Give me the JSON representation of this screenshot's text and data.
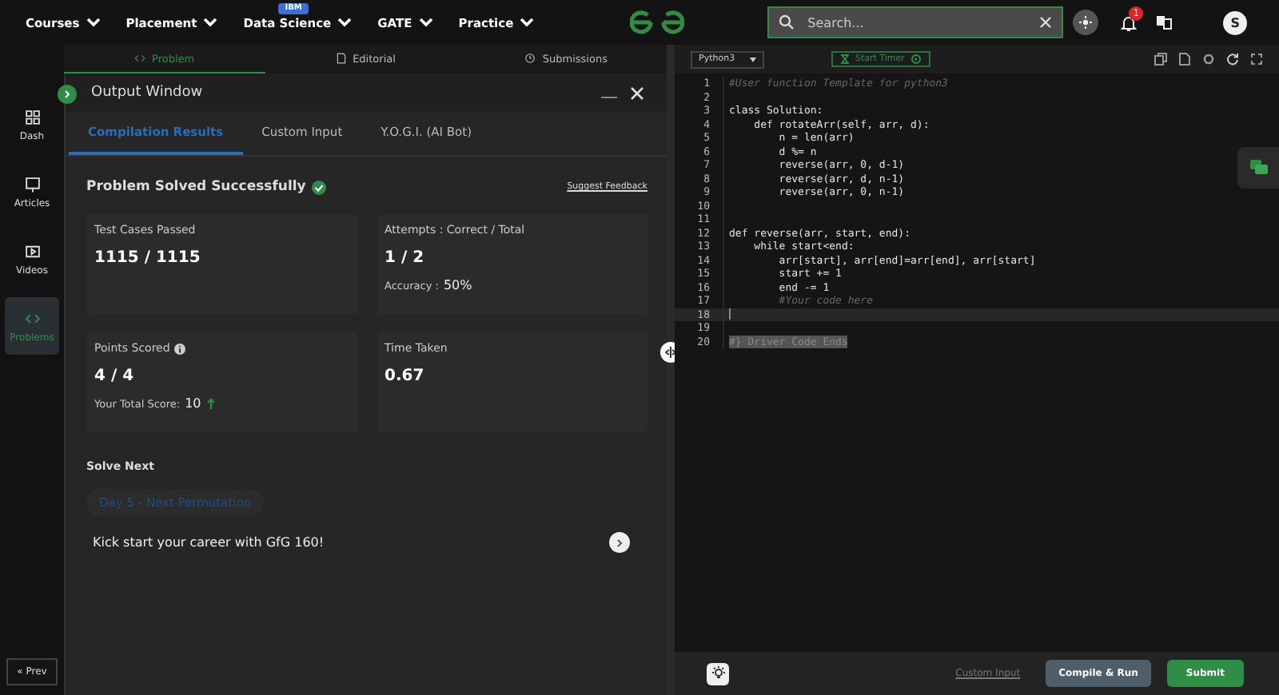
{
  "nav": {
    "items": [
      {
        "label": "Courses"
      },
      {
        "label": "Placement"
      },
      {
        "label": "Data Science",
        "badge": "IBM"
      },
      {
        "label": "GATE"
      },
      {
        "label": "Practice"
      }
    ],
    "search": {
      "placeholder": "Search..."
    },
    "notifications": "1",
    "avatar": "S"
  },
  "problem_tabs": [
    {
      "label": "Problem",
      "selected": true
    },
    {
      "label": "Editorial",
      "selected": false
    },
    {
      "label": "Submissions",
      "selected": false
    }
  ],
  "sidebar": {
    "items": [
      {
        "label": "Dash",
        "selected": false
      },
      {
        "label": "Articles",
        "selected": false
      },
      {
        "label": "Videos",
        "selected": false
      },
      {
        "label": "Problems",
        "selected": true
      }
    ],
    "prev": "« Prev"
  },
  "output_window": {
    "title": "Output Window",
    "tabs": [
      {
        "label": "Compilation Results",
        "selected": true
      },
      {
        "label": "Custom Input",
        "selected": false
      },
      {
        "label": "Y.O.G.I. (AI Bot)",
        "selected": false
      }
    ],
    "heading": "Problem Solved Successfully",
    "feedback": "Suggest Feedback",
    "cards": [
      {
        "label": "Test Cases Passed",
        "info": false,
        "value": "1115 / 1115",
        "rising": false
      },
      {
        "label": "Attempts : Correct / Total",
        "info": false,
        "value": "1 / 2",
        "note_label": "Accuracy :",
        "note_value": "50%",
        "rising": false
      },
      {
        "label": "Points Scored",
        "info": true,
        "value": "4 / 4",
        "note_label": "Your Total Score:",
        "note_value": "10",
        "rising": true
      },
      {
        "label": "Time Taken",
        "info": false,
        "value": "0.67",
        "rising": false
      }
    ],
    "solve_next": "Solve Next",
    "next_problem": "Day 5 - Next Permutation",
    "promo": "Kick start your career with GfG 160!"
  },
  "editor": {
    "language": "Python3",
    "timer": "Start Timer",
    "lines": [
      {
        "number": "1",
        "text": "#User function Template for python3",
        "kind": "comment",
        "current": false
      },
      {
        "number": "2",
        "current": false
      },
      {
        "number": "3",
        "text": "class Solution:",
        "kind": "code",
        "current": false
      },
      {
        "number": "4",
        "text": "    def rotateArr(self, arr, d):",
        "kind": "code",
        "current": false
      },
      {
        "number": "5",
        "text": "        n = len(arr)",
        "kind": "code",
        "current": false
      },
      {
        "number": "6",
        "text": "        d %= n",
        "kind": "code",
        "current": false
      },
      {
        "number": "7",
        "text": "        reverse(arr, 0, d-1)",
        "kind": "code",
        "current": false
      },
      {
        "number": "8",
        "text": "        reverse(arr, d, n-1)",
        "kind": "code",
        "current": false
      },
      {
        "number": "9",
        "text": "        reverse(arr, 0, n-1)",
        "kind": "code",
        "current": false
      },
      {
        "number": "10",
        "current": false
      },
      {
        "number": "11",
        "current": false
      },
      {
        "number": "12",
        "text": "def reverse(arr, start, end):",
        "kind": "code",
        "current": false
      },
      {
        "number": "13",
        "text": "    while start<end:",
        "kind": "code",
        "current": false
      },
      {
        "number": "14",
        "text": "        arr[start], arr[end]=arr[end], arr[start]",
        "kind": "code",
        "current": false
      },
      {
        "number": "15",
        "text": "        start += 1",
        "kind": "code",
        "current": false
      },
      {
        "number": "16",
        "text": "        end -= 1",
        "kind": "code",
        "current": false
      },
      {
        "number": "17",
        "text": "        #Your code here",
        "kind": "comment",
        "current": false
      },
      {
        "number": "18",
        "current": true
      },
      {
        "number": "19",
        "current": false
      },
      {
        "number": "20",
        "text": "#} Driver Code Ends",
        "kind": "selected",
        "current": false
      }
    ],
    "custom_input": "Custom Input",
    "compile": "Compile & Run",
    "submit": "Submit"
  }
}
